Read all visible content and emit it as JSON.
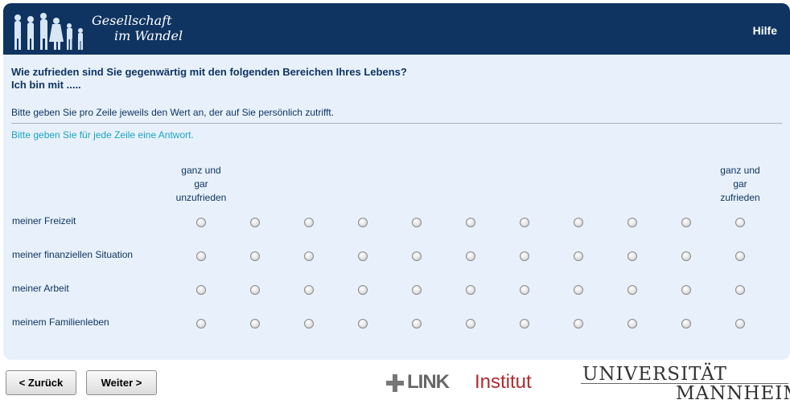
{
  "header": {
    "brand_line1": "Gesellschaft",
    "brand_line2": "im Wandel",
    "help_label": "Hilfe",
    "logo_icon": "people-silhouettes-icon"
  },
  "question": {
    "title_line1": "Wie zufrieden sind Sie gegenwärtig mit den folgenden Bereichen Ihres Lebens?",
    "title_line2": "Ich bin mit .....",
    "instruction": "Bitte geben Sie pro Zeile jeweils den Wert an, der auf Sie persönlich zutrifft.",
    "error": "Bitte geben Sie für jede Zeile eine Antwort."
  },
  "scale": {
    "left_anchor": [
      "ganz und",
      "gar",
      "unzufrieden"
    ],
    "right_anchor": [
      "ganz und",
      "gar",
      "zufrieden"
    ],
    "points": 11
  },
  "rows": [
    {
      "label": "meiner Freizeit",
      "selected": null
    },
    {
      "label": "meiner finanziellen Situation",
      "selected": null
    },
    {
      "label": "meiner Arbeit",
      "selected": null
    },
    {
      "label": "meinem Familienleben",
      "selected": null
    }
  ],
  "nav": {
    "back_label": "< Zurück",
    "next_label": "Weiter >"
  },
  "footer": {
    "link_word": "LINK",
    "link_institut": "Institut",
    "uni_line1": "UNIVERSITÄT",
    "uni_line2": "MANNHEIM"
  },
  "colors": {
    "header_bg": "#0f3461",
    "panel_bg": "#e8f1fb",
    "text": "#0f3461",
    "error": "#1aa3c0",
    "link_red": "#b02a30"
  }
}
